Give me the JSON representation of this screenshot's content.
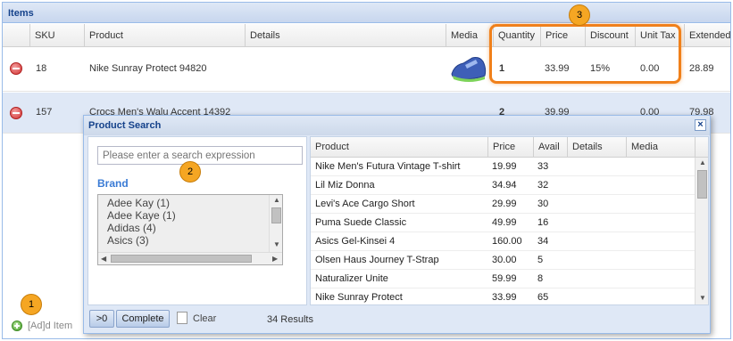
{
  "panel": {
    "title": "Items"
  },
  "columns": {
    "sku": "SKU",
    "product": "Product",
    "details": "Details",
    "media": "Media",
    "quantity": "Quantity",
    "price": "Price",
    "discount": "Discount",
    "unit_tax": "Unit Tax",
    "extended": "Extended"
  },
  "rows": [
    {
      "sku": "18",
      "product": "Nike Sunray Protect 94820",
      "quantity": "1",
      "price": "33.99",
      "discount": "15%",
      "unit_tax": "0.00",
      "extended": "28.89"
    },
    {
      "sku": "157",
      "product": "Crocs Men's Walu Accent 14392",
      "quantity": "2",
      "price": "39.99",
      "discount": "",
      "unit_tax": "0.00",
      "extended": "79.98"
    }
  ],
  "footer": {
    "add_label": "[Ad]d Item"
  },
  "callouts": {
    "c1": "1",
    "c2": "2",
    "c3": "3"
  },
  "dialog": {
    "title": "Product Search",
    "close_glyph": "×",
    "search_placeholder": "Please enter a search expression",
    "brand_label": "Brand",
    "brands": [
      "Adee Kay  (1)",
      "Adee Kaye  (1)",
      "Adidas  (4)",
      "Asics  (3)"
    ],
    "results_columns": {
      "product": "Product",
      "price": "Price",
      "avail": "Avail",
      "details": "Details",
      "media": "Media"
    },
    "results": [
      {
        "product": "Nike Men's Futura Vintage T-shirt",
        "price": "19.99",
        "avail": "33"
      },
      {
        "product": "Lil Miz Donna",
        "price": "34.94",
        "avail": "32"
      },
      {
        "product": "Levi's Ace Cargo Short",
        "price": "29.99",
        "avail": "30"
      },
      {
        "product": "Puma Suede Classic",
        "price": "49.99",
        "avail": "16"
      },
      {
        "product": "Asics Gel-Kinsei 4",
        "price": "160.00",
        "avail": "34"
      },
      {
        "product": "Olsen Haus Journey T-Strap",
        "price": "30.00",
        "avail": "5"
      },
      {
        "product": "Naturalizer Unite",
        "price": "59.99",
        "avail": "8"
      },
      {
        "product": "Nike Sunray Protect",
        "price": "33.99",
        "avail": "65"
      }
    ],
    "btn_gt0": ">0",
    "btn_complete": "Complete",
    "clear_label": "Clear",
    "results_count": "34 Results"
  },
  "icons": {
    "remove": "remove-circle-icon",
    "add": "add-circle-icon",
    "clear": "document-icon",
    "close": "close-icon"
  },
  "colors": {
    "header_blue": "#15428b",
    "brand_blue": "#3a7bd5",
    "callout_orange": "#f5a623",
    "highlight_border": "#f0801a"
  }
}
